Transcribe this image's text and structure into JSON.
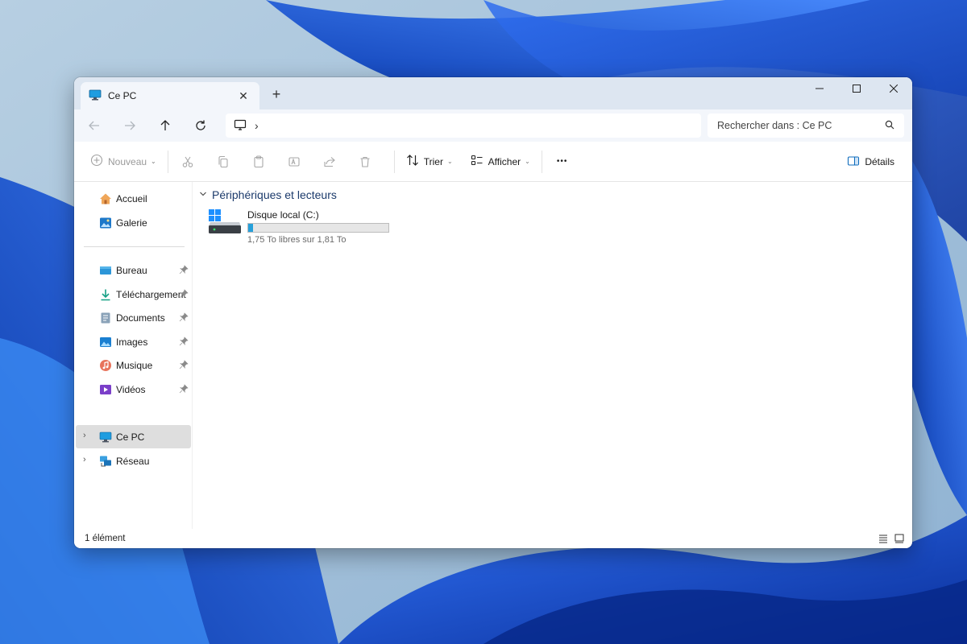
{
  "window": {
    "tab_title": "Ce PC",
    "new_tab_label": "+",
    "controls": {
      "minimize": "—",
      "maximize": "☐",
      "close": "✕"
    }
  },
  "addressbar": {
    "path_icon": "monitor-icon",
    "path_separator": "›",
    "search_placeholder": "Rechercher dans : Ce PC"
  },
  "toolbar": {
    "new_label": "Nouveau",
    "sort_label": "Trier",
    "view_label": "Afficher",
    "more_label": "•••",
    "details_label": "Détails",
    "disabled_actions": [
      "cut-icon",
      "copy-icon",
      "paste-icon",
      "rename-icon",
      "share-icon",
      "delete-icon"
    ]
  },
  "sidebar": {
    "top": [
      {
        "label": "Accueil",
        "icon": "home-icon"
      },
      {
        "label": "Galerie",
        "icon": "gallery-icon"
      }
    ],
    "pinned": [
      {
        "label": "Bureau",
        "icon": "desktop-folder-icon"
      },
      {
        "label": "Téléchargement",
        "icon": "download-icon"
      },
      {
        "label": "Documents",
        "icon": "documents-icon"
      },
      {
        "label": "Images",
        "icon": "images-icon"
      },
      {
        "label": "Musique",
        "icon": "music-icon"
      },
      {
        "label": "Vidéos",
        "icon": "videos-icon"
      }
    ],
    "locations": [
      {
        "label": "Ce PC",
        "icon": "pc-icon",
        "selected": true
      },
      {
        "label": "Réseau",
        "icon": "network-icon",
        "selected": false
      }
    ]
  },
  "main": {
    "group_title": "Périphériques et lecteurs",
    "drives": [
      {
        "name": "Disque local (C:)",
        "free_text": "1,75 To libres sur 1,81 To",
        "used_fraction": 0.033
      }
    ]
  },
  "statusbar": {
    "count_text": "1 élément"
  },
  "colors": {
    "accent": "#26a0da",
    "title_bar": "#dde6f1",
    "address_bar": "#f3f6fb",
    "group_title": "#1b3a6b",
    "selected_item": "#dedede"
  }
}
